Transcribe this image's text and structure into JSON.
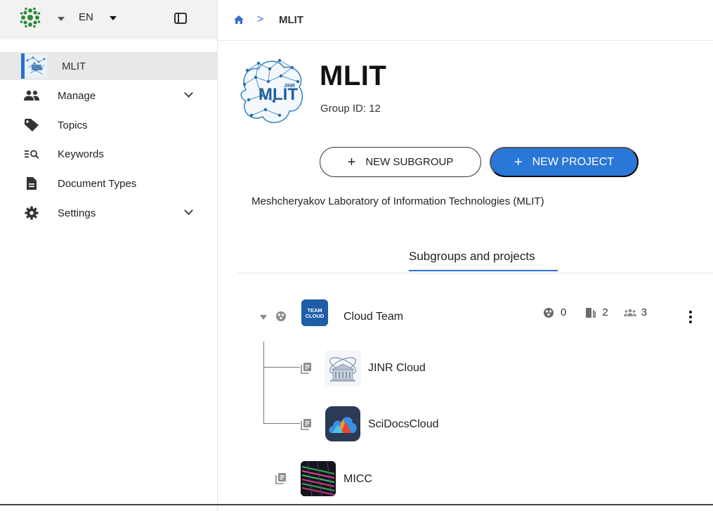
{
  "header": {
    "language": "EN"
  },
  "sidebar": {
    "group": "MLIT",
    "items": [
      {
        "label": "Manage"
      },
      {
        "label": "Topics"
      },
      {
        "label": "Keywords"
      },
      {
        "label": "Document Types"
      },
      {
        "label": "Settings"
      }
    ]
  },
  "breadcrumb": {
    "separator": ">",
    "current": "MLIT"
  },
  "group": {
    "title": "MLIT",
    "group_id": "Group ID: 12",
    "description": "Meshcheryakov Laboratory of Information Technologies (MLIT)",
    "avatar_text": "MLIT",
    "avatar_small_text": "JINR"
  },
  "actions": {
    "new_subgroup": "NEW SUBGROUP",
    "new_project": "NEW PROJECT"
  },
  "tabs": {
    "active": "Subgroups and projects"
  },
  "tree": {
    "subgroup": {
      "name": "Cloud Team",
      "avatar_text_1": "TEAM",
      "avatar_text_2": "CLOUD",
      "stats": {
        "subgroups": "0",
        "projects": "2",
        "members": "3"
      }
    },
    "children": [
      {
        "name": "JINR Cloud"
      },
      {
        "name": "SciDocsCloud"
      }
    ],
    "projects": [
      {
        "name": "MICC"
      }
    ]
  },
  "colors": {
    "accent": "#2977d7",
    "active_bar": "#2a6fd6",
    "sidebar_top": "#f2f2f2"
  }
}
